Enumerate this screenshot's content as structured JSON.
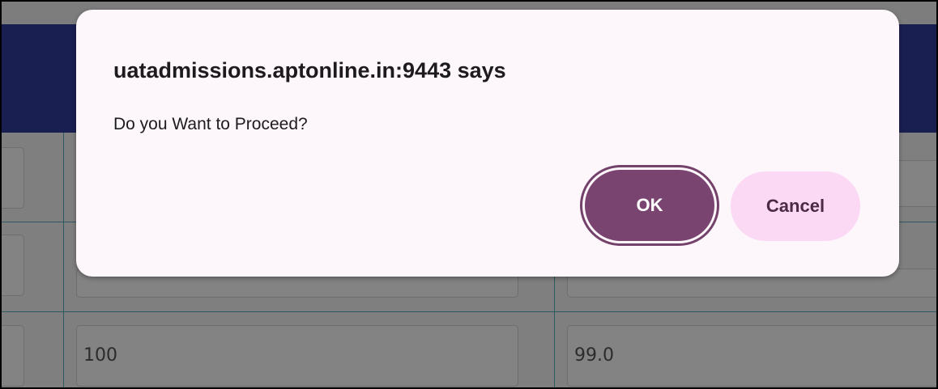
{
  "dialog": {
    "title": "uatadmissions.aptonline.in:9443 says",
    "message": "Do you Want to Proceed?",
    "ok_label": "OK",
    "cancel_label": "Cancel"
  },
  "background": {
    "row3_col2_value": "100",
    "row3_col3_value": "99.0"
  },
  "colors": {
    "header_bar": "#1a1f52",
    "overlay_gray": "#808080",
    "dialog_bg": "#fdf7fb",
    "ok_button": "#7a4470",
    "cancel_button": "#fbd9f4"
  }
}
